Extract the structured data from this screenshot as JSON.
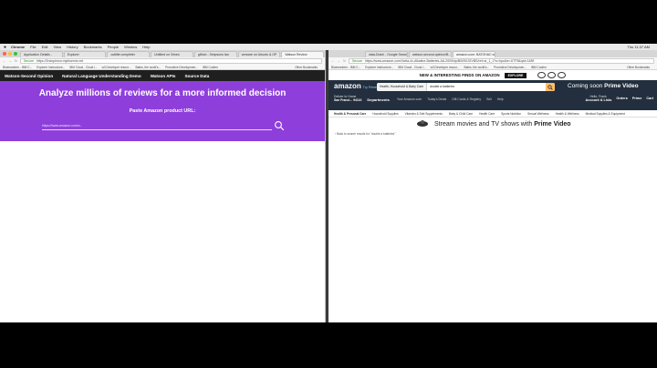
{
  "menubar": {
    "app": "Chrome",
    "items": [
      "File",
      "Edit",
      "View",
      "History",
      "Bookmarks",
      "People",
      "Window",
      "Help"
    ],
    "clock": "Thu 11:37 AM"
  },
  "left_window": {
    "tabs": [
      "Application Details -",
      "Explorer",
      "cuttitle completer",
      "Untitled on Vimeo",
      "github - Simpsons tan",
      "vmware on Ubuntu & OP",
      "Watson Review"
    ],
    "url": "https://2ndopinion.mybluemix.net",
    "secure": "Secure",
    "bookmarks": [
      "Bluemarkem - IBM C...",
      "Explorer Instrucione...",
      "IBM Cloud - Cloud i...",
      "w3 Developer resour...",
      "Bates, the world's...",
      "Promotive Developmen...",
      "IBM Codern"
    ],
    "other_bookmarks": "Other Bookmarks"
  },
  "watson": {
    "nav": [
      "Watson-Second Opinion",
      "Natural Language Understanding Demo",
      "Watson APIs",
      "Source Data"
    ],
    "headline": "Analyze millions of reviews for a more informed decision",
    "paste_label": "Paste Amazon product URL:",
    "url_placeholder": "https://www.amazon.com/v...",
    "colors": {
      "hero": "#8e3fdb",
      "nav": "#1f1f1f"
    }
  },
  "right_window": {
    "tabs": [
      "data-Dutch - Google Search",
      "watson-second-opinion/B...",
      "amazon.com: BATOHAC w..."
    ],
    "url": "https://www.amazon.com/Varta-4x-Alkaline-Batteries-AA-2009/dp/B0090JGVBS/ref=sr_1_1?s=hpc&ie=UTF8&qid=1489",
    "secure": "Secure",
    "bookmarks": [
      "Bluemarkem - IBM C...",
      "Explorer Instrucione...",
      "IBM Cloud - Cloud i...",
      "w3 Developer resour...",
      "Bates, the world's...",
      "Promotive Developmen...",
      "IBM Codern"
    ],
    "other_bookmarks": "Other Bookmarks"
  },
  "amazon": {
    "banner": "NEW & INTERESTING FINDS ON AMAZON",
    "explore": "EXPLORE",
    "logo": "amazon",
    "logo_sub": "Try Prime",
    "search_category": "Health, Household & Baby Care",
    "search_term": "double a batteries",
    "coming_soon": "Coming soon",
    "prime_video": "Prime Video",
    "deliver_line1": "Deliver to Home",
    "deliver_line2": "San Franci... 94110",
    "departments": "Departments",
    "sub_links": [
      "Your Amazon.com",
      "Today's Deals",
      "Gift Cards & Registry",
      "Sell",
      "Help"
    ],
    "account_top": "Hello, Frank",
    "account": "Account & Lists",
    "orders": "Orders",
    "prime": "Prime",
    "cart": "Cart",
    "categories": [
      "Health & Personal Care",
      "Household Supplies",
      "Vitamins & Diet Supplements",
      "Baby & Child Care",
      "Health Care",
      "Sports Nutrition",
      "Sexual Wellness",
      "Health & Wellness",
      "Medical Supplies & Equipment"
    ],
    "promo_text": "Stream movies and TV shows with",
    "promo_bold": "Prime Video",
    "back_link": "‹ Back to search results for \"double a batteries\"",
    "colors": {
      "header": "#232f3e",
      "search_button": "#febd69"
    }
  }
}
